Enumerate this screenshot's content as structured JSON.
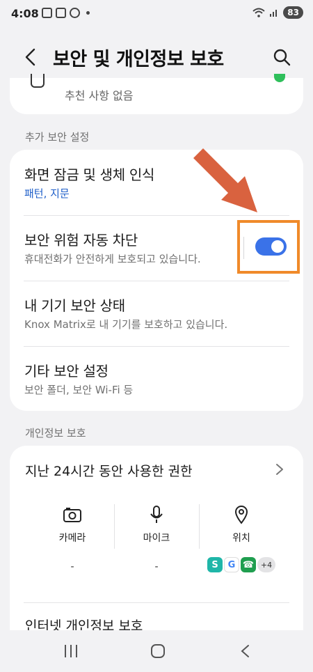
{
  "status_bar": {
    "time": "4:08",
    "battery": "83",
    "icons": [
      "screenshot-icon",
      "gallery-icon",
      "check-circle-icon",
      "dot-icon",
      "wifi-icon",
      "signal-icon",
      "battery-icon"
    ]
  },
  "header": {
    "title": "보안 및 개인정보 보호",
    "back_icon": "back-chevron-icon",
    "search_icon": "search-icon"
  },
  "recommendation": {
    "text": "추천 사항 없음"
  },
  "security_section": {
    "label": "추가 보안 설정",
    "items": [
      {
        "title": "화면 잠금 및 생체 인식",
        "subtitle": "패턴, 지문"
      },
      {
        "title": "보안 위험 자동 차단",
        "subtitle": "휴대전화가 안전하게 보호되고 있습니다.",
        "toggle_on": true
      },
      {
        "title": "내 기기 보안 상태",
        "subtitle": "Knox Matrix로 내 기기를 보호하고 있습니다."
      },
      {
        "title": "기타 보안 설정",
        "subtitle": "보안 폴더, 보안 Wi-Fi 등"
      }
    ]
  },
  "privacy_section": {
    "label": "개인정보 보호",
    "permissions_title": "지난 24시간 동안 사용한 권한",
    "columns": [
      {
        "label": "카메라",
        "value": "-",
        "icon": "camera-icon"
      },
      {
        "label": "마이크",
        "value": "-",
        "icon": "microphone-icon"
      },
      {
        "label": "위치",
        "icon": "location-pin-icon",
        "apps": [
          "S",
          "G",
          "☎"
        ],
        "more": "+4"
      }
    ],
    "next_item": "인터넷 개인정보 보호"
  },
  "colors": {
    "accent": "#3a72e8",
    "annotation": "#f08a2a",
    "arrow": "#d9623f"
  }
}
